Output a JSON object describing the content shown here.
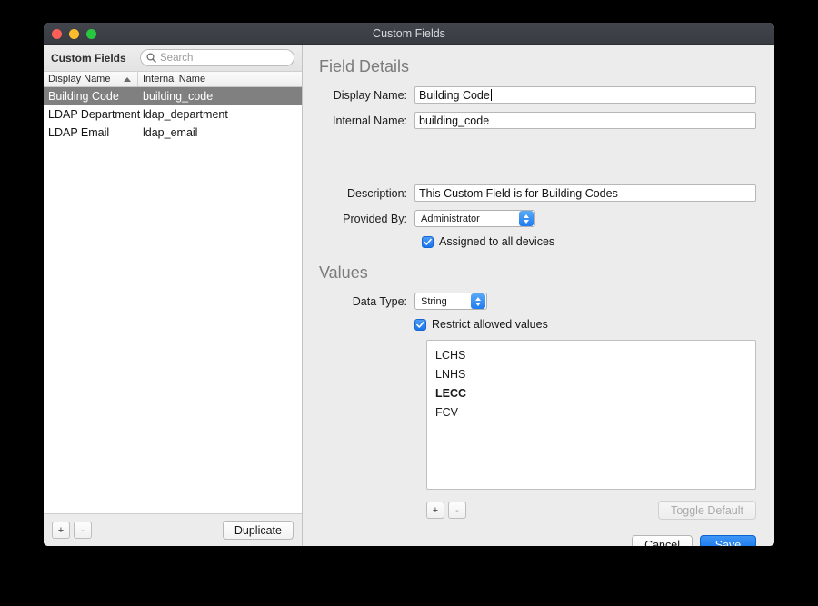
{
  "window": {
    "title": "Custom Fields",
    "traffic_lights": [
      "close-button",
      "minimize-button",
      "maximize-button"
    ]
  },
  "sidebar": {
    "heading": "Custom Fields",
    "search": {
      "value": "",
      "placeholder": "Search",
      "icon": "search-icon"
    },
    "columns": [
      "Display Name",
      "Internal Name"
    ],
    "sort": {
      "column": "Display Name",
      "direction": "ascending",
      "icon": "sort-ascending-icon"
    },
    "rows": [
      {
        "display_name": "Building Code",
        "internal_name": "building_code",
        "selected": true
      },
      {
        "display_name": "LDAP Department",
        "internal_name": "ldap_department",
        "selected": false
      },
      {
        "display_name": "LDAP Email",
        "internal_name": "ldap_email",
        "selected": false
      }
    ],
    "footer": {
      "add_label": "+",
      "remove_label": "-",
      "duplicate_label": "Duplicate"
    }
  },
  "detail": {
    "field_details": {
      "title": "Field Details",
      "display_name_label": "Display Name:",
      "display_name_value": "Building Code",
      "internal_name_label": "Internal Name:",
      "internal_name_value": "building_code",
      "description_label": "Description:",
      "description_value": "This Custom Field is for Building Codes",
      "provided_by_label": "Provided By:",
      "provided_by_value": "Administrator",
      "assigned_all_label": "Assigned to all devices",
      "assigned_all_checked": true
    },
    "values": {
      "title": "Values",
      "data_type_label": "Data Type:",
      "data_type_value": "String",
      "restrict_label": "Restrict allowed values",
      "restrict_checked": true,
      "items": [
        {
          "label": "LCHS",
          "is_default": false
        },
        {
          "label": "LNHS",
          "is_default": false
        },
        {
          "label": "LECC",
          "is_default": true
        },
        {
          "label": "FCV",
          "is_default": false
        }
      ],
      "add_label": "+",
      "remove_label": "-",
      "toggle_default_label": "Toggle Default",
      "toggle_default_enabled": false
    },
    "footer": {
      "cancel_label": "Cancel",
      "save_label": "Save"
    }
  },
  "colors": {
    "accent_blue": "#1f7bef",
    "save_blue": "#1472ea",
    "titlebar": "#3c4046",
    "panel_bg": "#ececec",
    "selection_gray": "#808080"
  }
}
